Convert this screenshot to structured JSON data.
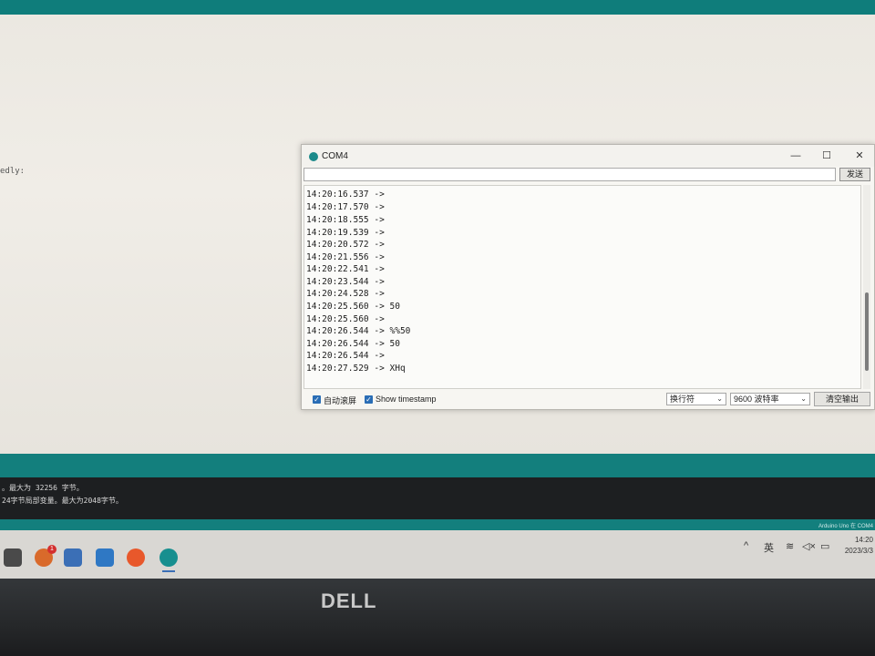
{
  "editor": {
    "fragment": "edly:"
  },
  "serial_monitor": {
    "title": "COM4",
    "send_input_value": "",
    "send_button": "发送",
    "lines": [
      "14:20:16.537 ->",
      "14:20:17.570 ->",
      "14:20:18.555 ->",
      "14:20:19.539 ->",
      "14:20:20.572 ->",
      "14:20:21.556 ->",
      "14:20:22.541 ->",
      "14:20:23.544 ->",
      "14:20:24.528 ->",
      "14:20:25.560 -> 50",
      "14:20:25.560 ->",
      "14:20:26.544 -> %%50",
      "14:20:26.544 -> 50",
      "14:20:26.544 ->",
      "14:20:27.529 -> XHq"
    ],
    "autoscroll_label": "自动滚屏",
    "autoscroll_checked": true,
    "timestamp_label": "Show timestamp",
    "timestamp_checked": true,
    "line_ending": "换行符",
    "baud_rate": "9600 波特率",
    "clear_button": "清空输出",
    "window_controls": {
      "minimize": "—",
      "maximize": "☐",
      "close": "✕"
    }
  },
  "console": {
    "lines": [
      "。最大为 32256 字节。",
      "24字节局部变量。最大为2048字节。"
    ]
  },
  "ide_status": "Arduino Uno 在 COM4",
  "taskbar": {
    "notification_badge": "1",
    "icons": [
      "file-explorer-icon",
      "app-icon",
      "store-icon",
      "mail-icon",
      "firefox-icon",
      "arduino-icon"
    ],
    "tray": {
      "ime": "英",
      "chevron": "^"
    },
    "clock_time": "14:20",
    "clock_date": "2023/3/3"
  },
  "bezel": {
    "logo": "DELL"
  },
  "colors": {
    "teal": "#137f7d",
    "checkbox": "#2a6db5"
  }
}
